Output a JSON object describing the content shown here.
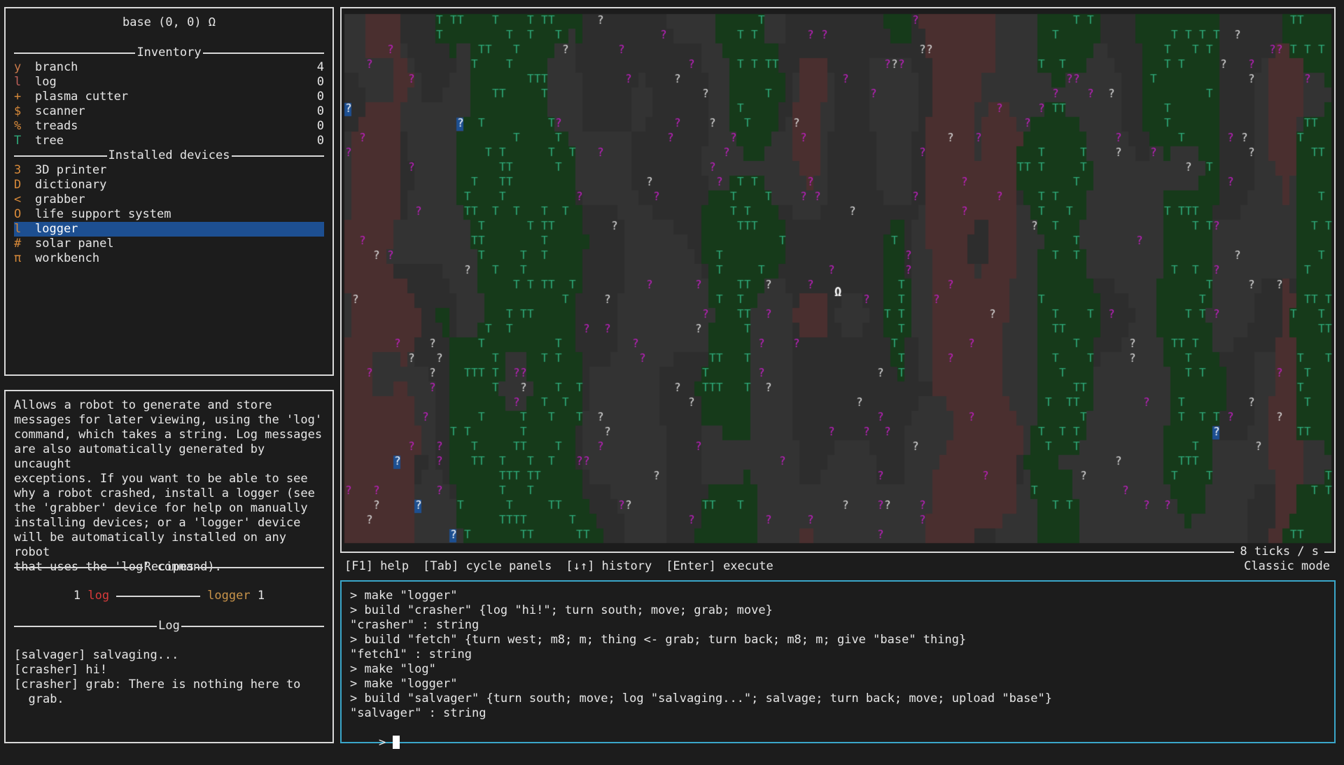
{
  "robot_panel": {
    "title": "base  (0, 0)  Ω",
    "inventory_header": "Inventory",
    "inventory": [
      {
        "sym": "y",
        "name": "branch",
        "qty": "4",
        "color": "#c97a4a"
      },
      {
        "sym": "l",
        "name": "log",
        "qty": "0",
        "color": "#c0605a"
      },
      {
        "sym": "+",
        "name": "plasma cutter",
        "qty": "0",
        "color": "#d88a3a"
      },
      {
        "sym": "$",
        "name": "scanner",
        "qty": "0",
        "color": "#d88a3a"
      },
      {
        "sym": "%",
        "name": "treads",
        "qty": "0",
        "color": "#d88a3a"
      },
      {
        "sym": "T",
        "name": "tree",
        "qty": "0",
        "color": "#2fa97a"
      }
    ],
    "devices_header": "Installed devices",
    "devices": [
      {
        "sym": "3",
        "name": "3D printer",
        "color": "#d88a3a",
        "selected": false
      },
      {
        "sym": "D",
        "name": "dictionary",
        "color": "#d88a3a",
        "selected": false
      },
      {
        "sym": "<",
        "name": "grabber",
        "color": "#d88a3a",
        "selected": false
      },
      {
        "sym": "O",
        "name": "life support system",
        "color": "#d88a3a",
        "selected": false
      },
      {
        "sym": "l",
        "name": "logger",
        "color": "#d88a3a",
        "selected": true
      },
      {
        "sym": "#",
        "name": "solar panel",
        "color": "#d88a3a",
        "selected": false
      },
      {
        "sym": "π",
        "name": "workbench",
        "color": "#d88a3a",
        "selected": false
      }
    ]
  },
  "info_panel": {
    "description": "Allows a robot to generate and store\nmessages for later viewing, using the 'log'\ncommand, which takes a string. Log messages\nare also automatically generated by uncaught\nexceptions. If you want to be able to see\nwhy a robot crashed, install a logger (see\nthe 'grabber' device for help on manually\ninstalling devices; or a 'logger' device\nwill be automatically installed on any robot\nthat uses the 'log' command).",
    "recipes_header": "Recipes",
    "recipe": {
      "in_qty": "1",
      "in_name": "log",
      "out_name": "logger",
      "out_qty": "1"
    },
    "log_header": "Log",
    "log": [
      "[salvager] salvaging...",
      "[crasher] hi!",
      "[crasher] grab: There is nothing here to\n  grab."
    ]
  },
  "world": {
    "ticks": "8 ticks / s",
    "base_symbol": "Ω"
  },
  "help_bar": {
    "items": [
      "[F1] help",
      "[Tab] cycle panels",
      "[↓↑] history",
      "[Enter] execute"
    ],
    "mode": "Classic mode"
  },
  "repl": {
    "history": [
      "> make \"logger\"",
      "> build \"crasher\" {log \"hi!\"; turn south; move; grab; move}",
      "\"crasher\" : string",
      "> build \"fetch\" {turn west; m8; m; thing <- grab; turn back; m8; m; give \"base\" thing}",
      "\"fetch1\" : string",
      "> make \"log\"",
      "> make \"logger\"",
      "> build \"salvager\" {turn south; move; log \"salvaging...\"; salvage; turn back; move; upload \"base\"}",
      "\"salvager\" : string"
    ],
    "prompt": "> "
  },
  "colors": {
    "accent": "#3aa6c9",
    "selection": "#1d4f91",
    "tree": "#2fa97a",
    "unknown_purple": "#c020c0",
    "unknown_blue_bg": "#1d4f91",
    "ground_dark": "#2d2d2d",
    "ground_grass": "#163a1a",
    "ground_red": "#4a2f2f"
  }
}
